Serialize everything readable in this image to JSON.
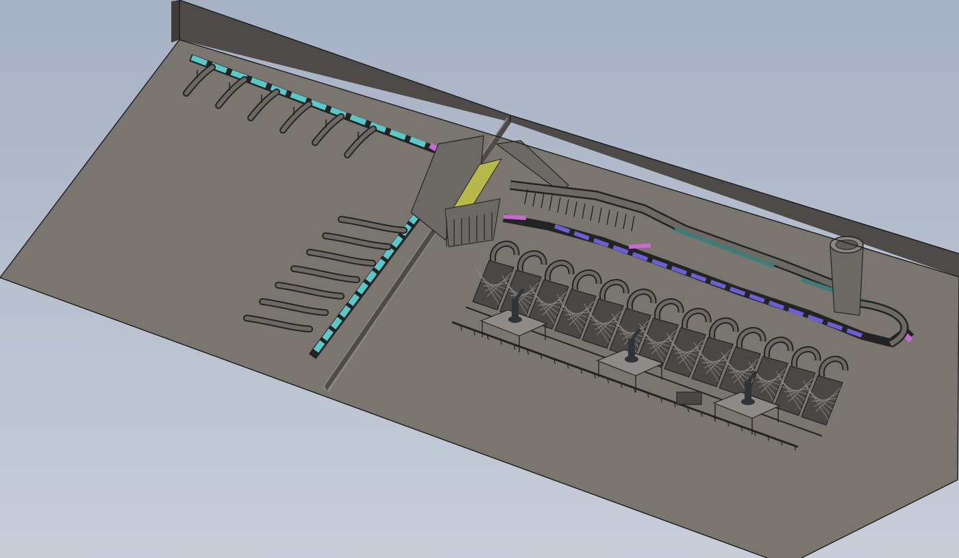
{
  "colors": {
    "background_top": "#a6b1c4",
    "background_bottom": "#c7ced9",
    "floor": "#7b7570",
    "wall": "#4d4a48",
    "wall_dark": "#3f3c3a",
    "divider_face": "#8a847f",
    "machine": "#6c6864",
    "machine_line": "#232323",
    "conveyor_cyan": "#5cc7c9",
    "conveyor_magenta": "#c66ad3",
    "conveyor_violet": "#6c5fd4",
    "conveyor_teal": "#3f7b77",
    "conveyor_yellow": "#b9b84a",
    "robot": "#2f3438"
  },
  "icons": {
    "robot": "robot-arm-icon",
    "silo": "cylinder-hopper-icon"
  },
  "scene": {
    "type": "isometric 3D CAD view of a factory floor layout",
    "rooms": 2,
    "left_room_chutes_top_row": 6,
    "left_room_chutes_diagonal": 7,
    "right_room_rack_units": 13,
    "robots": 3
  }
}
